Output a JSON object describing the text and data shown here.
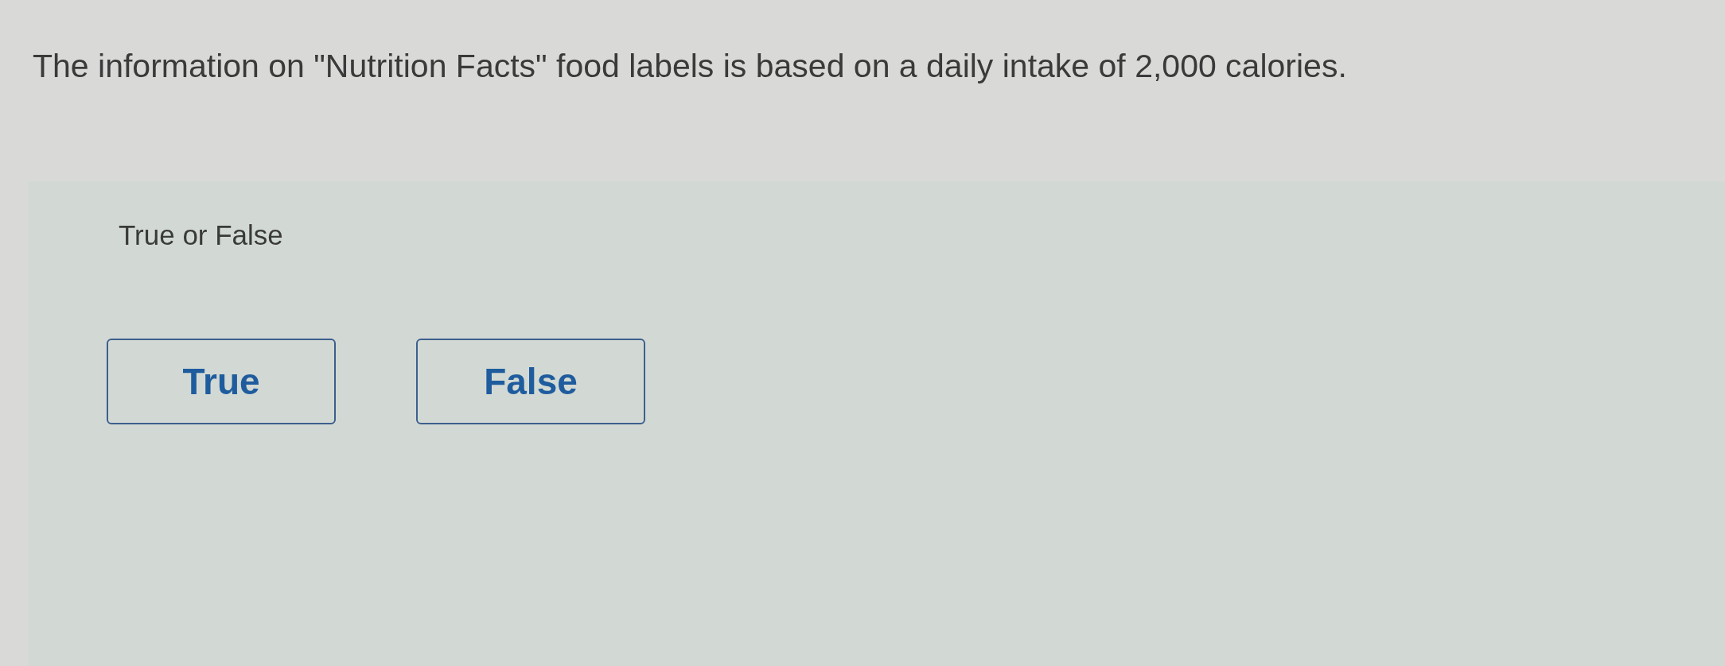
{
  "question": {
    "text": "The information on \"Nutrition Facts\" food labels is based on a daily intake of 2,000 calories."
  },
  "answer_panel": {
    "prompt": "True or False",
    "options": [
      {
        "label": "True",
        "selected": false
      },
      {
        "label": "False",
        "selected": false
      }
    ]
  }
}
